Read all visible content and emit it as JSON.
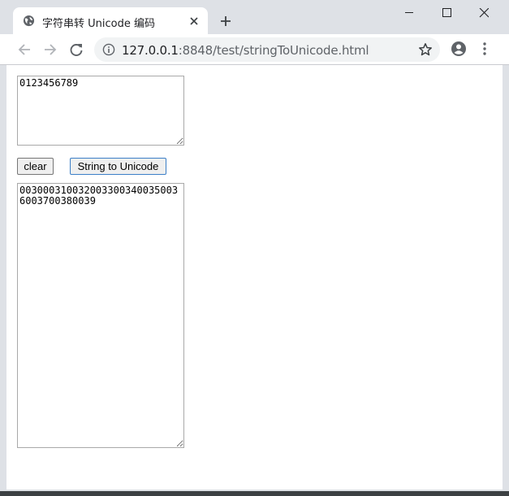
{
  "tab": {
    "title": "字符串转 Unicode 编码"
  },
  "address_bar": {
    "host": "127.0.0.1",
    "port_and_path": ":8848/test/stringToUnicode.html"
  },
  "page": {
    "input_text": "0123456789",
    "clear_label": "clear",
    "convert_label": "String to Unicode",
    "output_text": "003000310032003300340035003600370038003 9"
  },
  "icons": {
    "favicon": "globe-icon",
    "tab_close": "close-icon",
    "new_tab": "plus-icon",
    "back": "arrow-left-icon",
    "forward": "arrow-right-icon",
    "reload": "reload-icon",
    "site_info": "info-icon",
    "bookmark": "star-icon",
    "profile": "account-icon",
    "menu": "kebab-menu-icon"
  },
  "colors": {
    "focus_border": "#3c7fc7",
    "chrome_bg": "#dee1e6"
  }
}
